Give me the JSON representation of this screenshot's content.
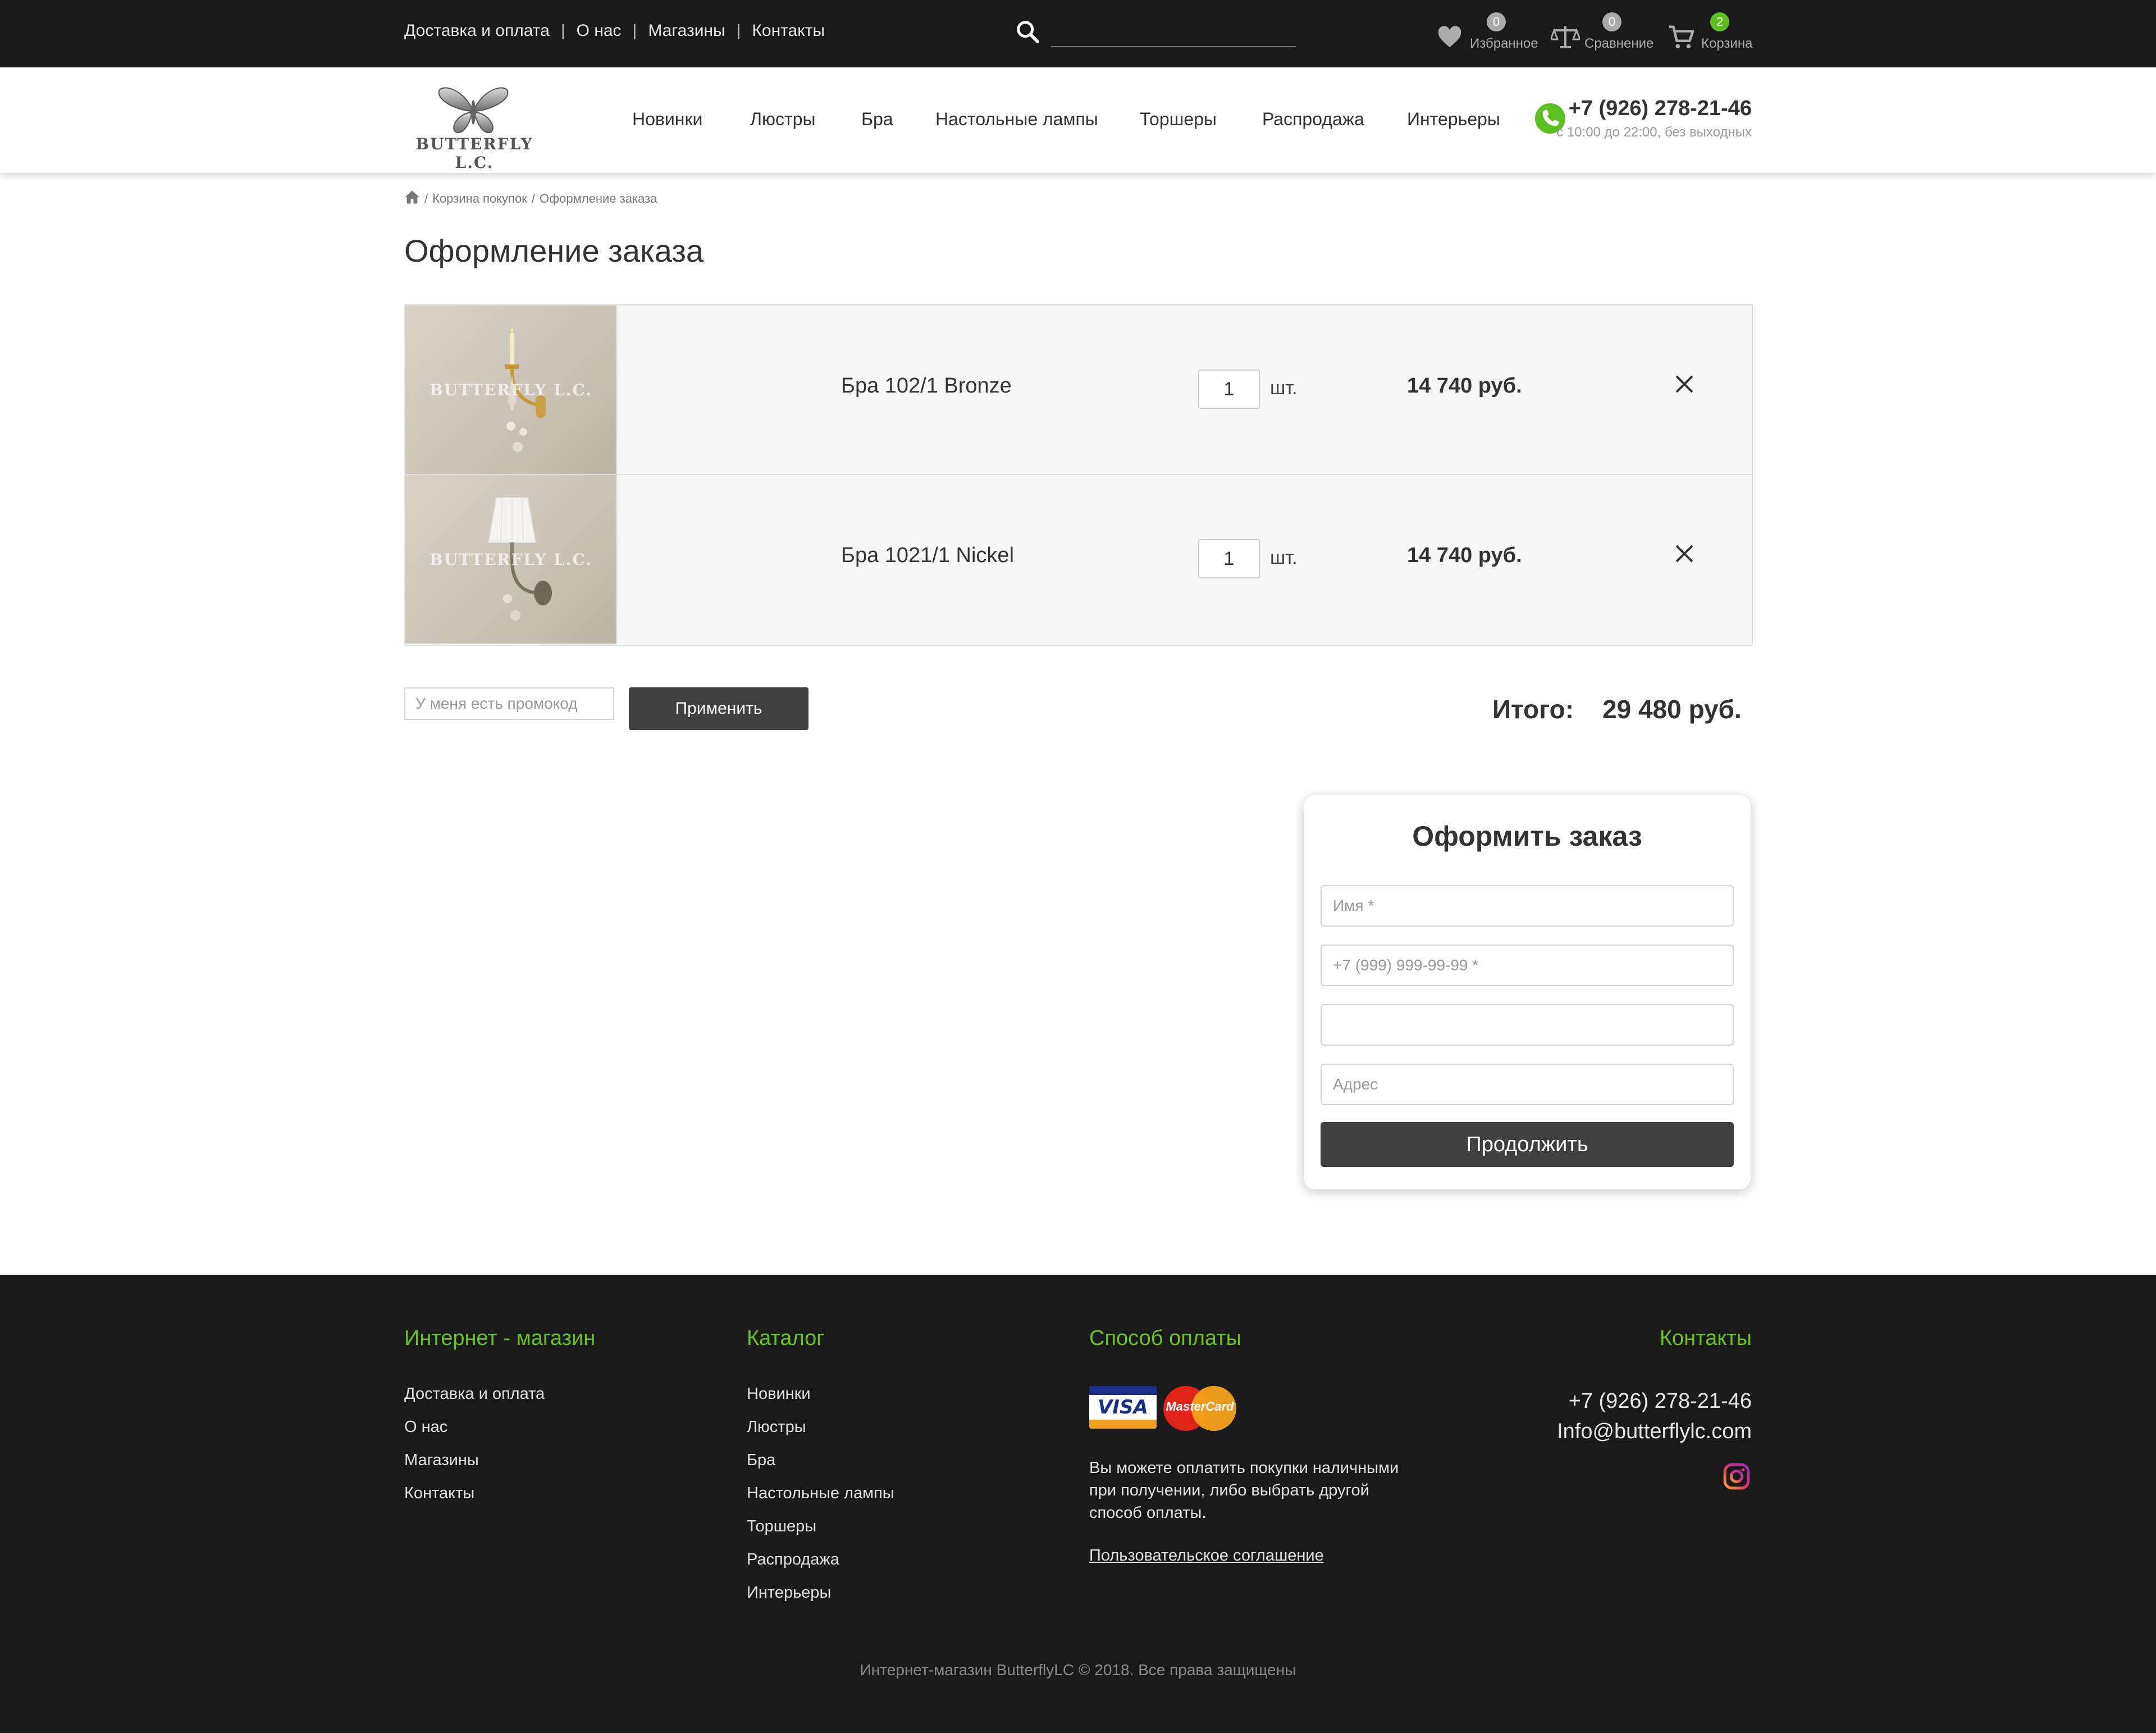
{
  "topbar": {
    "links": [
      "Доставка и оплата",
      "О нас",
      "Магазины",
      "Контакты"
    ],
    "separator": "|",
    "favorites": {
      "count": "0",
      "label": "Избранное"
    },
    "compare": {
      "count": "0",
      "label": "Сравнение"
    },
    "cart": {
      "count": "2",
      "label": "Корзина"
    }
  },
  "header": {
    "logo_text": "BUTTERFLY L.C.",
    "nav": [
      "Новинки",
      "Люстры",
      "Бра",
      "Настольные лампы",
      "Торшеры",
      "Распродажа",
      "Интерьеры"
    ],
    "phone": "+7 (926) 278-21-46",
    "hours": "с 10:00 до 22:00, без выходных"
  },
  "breadcrumb": {
    "items": [
      "Корзина покупок",
      "Оформление заказа"
    ],
    "separator": "/"
  },
  "page_title": "Оформление заказа",
  "cart_items": [
    {
      "name": "Бра 102/1 Bronze",
      "qty": "1",
      "unit": "шт.",
      "price": "14 740 руб.",
      "watermark": "BUTTERFLY L.C."
    },
    {
      "name": "Бра 1021/1 Nickel",
      "qty": "1",
      "unit": "шт.",
      "price": "14 740 руб.",
      "watermark": "BUTTERFLY L.C."
    }
  ],
  "promo": {
    "placeholder": "У меня есть промокод",
    "button": "Применить"
  },
  "total": {
    "label": "Итого:",
    "value": "29 480 руб."
  },
  "order_form": {
    "title": "Оформить заказ",
    "name_placeholder": "Имя *",
    "phone_placeholder": "+7 (999) 999-99-99 *",
    "extra_placeholder": "",
    "address_placeholder": "Адрес",
    "submit": "Продолжить"
  },
  "footer": {
    "shop": {
      "title": "Интернет - магазин",
      "links": [
        "Доставка и оплата",
        "О нас",
        "Магазины",
        "Контакты"
      ]
    },
    "catalog": {
      "title": "Каталог",
      "links": [
        "Новинки",
        "Люстры",
        "Бра",
        "Настольные лампы",
        "Торшеры",
        "Распродажа",
        "Интерьеры"
      ]
    },
    "payment": {
      "title": "Способ оплаты",
      "visa": "VISA",
      "mastercard": "MasterCard",
      "text": "Вы можете оплатить покупки наличными при получении, либо выбрать другой способ оплаты.",
      "agreement": "Пользовательское соглашение"
    },
    "contacts": {
      "title": "Контакты",
      "phone": "+7 (926) 278-21-46",
      "email": "Info@butterflylc.com"
    },
    "copyright": "Интернет-магазин ButterflyLC © 2018. Все права защищены"
  },
  "colors": {
    "accent_green": "#5cbf1e",
    "dark_bg": "#1a1a1a",
    "button_dark": "#404040"
  }
}
